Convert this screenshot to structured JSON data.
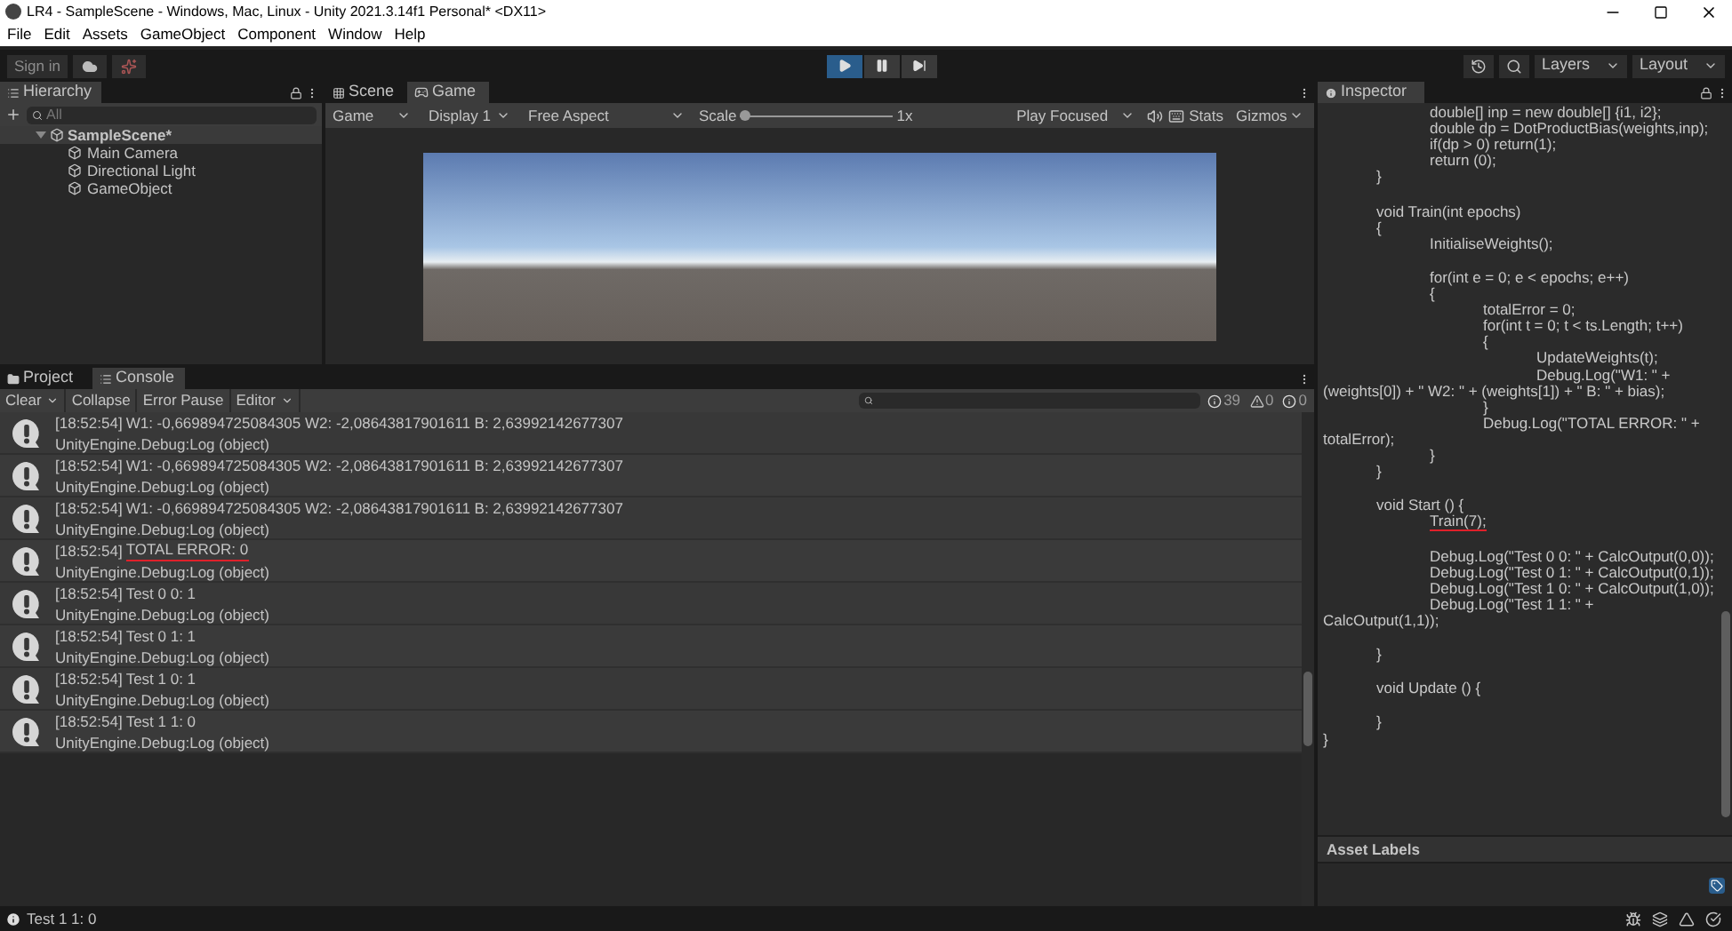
{
  "window": {
    "title": "LR4 - SampleScene - Windows, Mac, Linux - Unity 2021.3.14f1 Personal* <DX11>"
  },
  "menu": [
    "File",
    "Edit",
    "Assets",
    "GameObject",
    "Component",
    "Window",
    "Help"
  ],
  "toolbar": {
    "sign_in": "Sign in",
    "playing": true,
    "paused": false,
    "layers": "Layers",
    "layout": "Layout"
  },
  "hierarchy": {
    "tab": "Hierarchy",
    "search_placeholder": "All",
    "scene": {
      "name": "SampleScene*",
      "expanded": true,
      "children": [
        {
          "name": "Main Camera"
        },
        {
          "name": "Directional Light"
        },
        {
          "name": "GameObject"
        }
      ]
    }
  },
  "game_view": {
    "tabs": [
      {
        "label": "Scene",
        "selected": false
      },
      {
        "label": "Game",
        "selected": true
      }
    ],
    "mode": "Game",
    "display": "Display 1",
    "aspect": "Free Aspect",
    "scale_label": "Scale",
    "scale": "1x",
    "scale_slider": {
      "level": 0
    },
    "play_mode": "Play Focused",
    "stats": "Stats",
    "gizmos": "Gizmos"
  },
  "console": {
    "tabs": [
      {
        "label": "Project",
        "selected": false
      },
      {
        "label": "Console",
        "selected": true
      }
    ],
    "toolbar": [
      "Clear",
      "Collapse",
      "Error Pause",
      "Editor"
    ],
    "counts": {
      "log": "39",
      "warning": "0",
      "error": "0"
    },
    "rows": [
      {
        "time": "[18:52:54]",
        "message": "W1: -0,669894725084305 W2: -2,08643817901611 B: 2,63992142677307",
        "source": "UnityEngine.Debug:Log (object)",
        "underlined": false
      },
      {
        "time": "[18:52:54]",
        "message": "W1: -0,669894725084305 W2: -2,08643817901611 B: 2,63992142677307",
        "source": "UnityEngine.Debug:Log (object)",
        "underlined": false
      },
      {
        "time": "[18:52:54]",
        "message": "W1: -0,669894725084305 W2: -2,08643817901611 B: 2,63992142677307",
        "source": "UnityEngine.Debug:Log (object)",
        "underlined": false
      },
      {
        "time": "[18:52:54]",
        "message": "TOTAL ERROR: 0",
        "source": "UnityEngine.Debug:Log (object)",
        "underlined": true
      },
      {
        "time": "[18:52:54]",
        "message": "Test 0 0: 1",
        "source": "UnityEngine.Debug:Log (object)",
        "underlined": false
      },
      {
        "time": "[18:52:54]",
        "message": "Test 0 1: 1",
        "source": "UnityEngine.Debug:Log (object)",
        "underlined": false
      },
      {
        "time": "[18:52:54]",
        "message": "Test 1 0: 1",
        "source": "UnityEngine.Debug:Log (object)",
        "underlined": false
      },
      {
        "time": "[18:52:54]",
        "message": "Test 1 1: 0",
        "source": "UnityEngine.Debug:Log (object)",
        "underlined": false
      }
    ]
  },
  "inspector": {
    "tab": "Inspector",
    "asset_labels": "Asset Labels",
    "lines": [
      {
        "text": "\t\tdouble[] inp = new double[] {i1, i2};",
        "blank_before": false,
        "underlined": false
      },
      {
        "text": "\t\tdouble dp = DotProductBias(weights,inp);",
        "blank_before": false,
        "underlined": false
      },
      {
        "text": "\t\tif(dp > 0) return(1);",
        "blank_before": false,
        "underlined": false
      },
      {
        "text": "\t\treturn (0);",
        "blank_before": false,
        "underlined": false
      },
      {
        "text": "\t}",
        "blank_before": false,
        "underlined": false
      },
      {
        "text": "\tvoid Train(int epochs)",
        "blank_before": true,
        "underlined": false
      },
      {
        "text": "\t{",
        "blank_before": false,
        "underlined": false
      },
      {
        "text": "\t\tInitialiseWeights();",
        "blank_before": false,
        "underlined": false
      },
      {
        "text": "\t\tfor(int e = 0; e < epochs; e++)",
        "blank_before": true,
        "underlined": false
      },
      {
        "text": "\t\t{",
        "blank_before": false,
        "underlined": false
      },
      {
        "text": "\t\t\ttotalError = 0;",
        "blank_before": false,
        "underlined": false
      },
      {
        "text": "\t\t\tfor(int t = 0; t < ts.Length; t++)",
        "blank_before": false,
        "underlined": false
      },
      {
        "text": "\t\t\t{",
        "blank_before": false,
        "underlined": false
      },
      {
        "text": "\t\t\t\tUpdateWeights(t);",
        "blank_before": false,
        "underlined": false
      },
      {
        "text": "\t\t\t\tDebug.Log(\"W1: \" +",
        "blank_before": false,
        "underlined": false
      },
      {
        "text": "(weights[0]) + \" W2: \" + (weights[1]) + \" B: \" + bias);",
        "blank_before": false,
        "underlined": false
      },
      {
        "text": "\t\t\t}",
        "blank_before": false,
        "underlined": false
      },
      {
        "text": "\t\t\tDebug.Log(\"TOTAL ERROR: \" +",
        "blank_before": false,
        "underlined": false
      },
      {
        "text": "totalError);",
        "blank_before": false,
        "underlined": false
      },
      {
        "text": "\t\t}",
        "blank_before": false,
        "underlined": false
      },
      {
        "text": "\t}",
        "blank_before": false,
        "underlined": false
      },
      {
        "text": "\tvoid Start () {",
        "blank_before": true,
        "underlined": false
      },
      {
        "text": "\t\tTrain(7);",
        "blank_before": false,
        "underlined": true
      },
      {
        "text": "\t\tDebug.Log(\"Test 0 0: \" + CalcOutput(0,0));",
        "blank_before": true,
        "underlined": false
      },
      {
        "text": "\t\tDebug.Log(\"Test 0 1: \" + CalcOutput(0,1));",
        "blank_before": false,
        "underlined": false
      },
      {
        "text": "\t\tDebug.Log(\"Test 1 0: \" + CalcOutput(1,0));",
        "blank_before": false,
        "underlined": false
      },
      {
        "text": "\t\tDebug.Log(\"Test 1 1: \" +",
        "blank_before": false,
        "underlined": false
      },
      {
        "text": "CalcOutput(1,1));",
        "blank_before": false,
        "underlined": false
      },
      {
        "text": "\t}",
        "blank_before": true,
        "underlined": false
      },
      {
        "text": "\tvoid Update () {",
        "blank_before": true,
        "underlined": false
      },
      {
        "text": "\t}",
        "blank_before": true,
        "underlined": false
      },
      {
        "text": "}",
        "blank_before": false,
        "underlined": false
      }
    ]
  },
  "status_bar": {
    "message": "Test 1 1: 0"
  }
}
